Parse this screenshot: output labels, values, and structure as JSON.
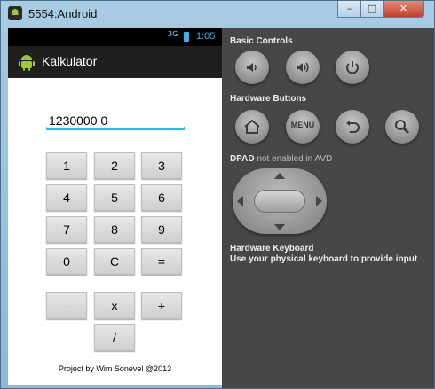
{
  "window": {
    "title": "5554:Android",
    "minimize_icon": "minimize-icon",
    "maximize_icon": "maximize-icon",
    "close_icon": "close-icon"
  },
  "statusbar": {
    "signal": "3G",
    "time": "1:05"
  },
  "app": {
    "title": "Kalkulator",
    "icon": "android-robot-icon"
  },
  "calculator": {
    "display": "1230000.0",
    "keys": [
      "1",
      "2",
      "3",
      "4",
      "5",
      "6",
      "7",
      "8",
      "9",
      "0",
      "C",
      "=",
      "-",
      "x",
      "+",
      "/"
    ],
    "footer": "Project by Wim Sonevel @2013"
  },
  "controls": {
    "basic_title": "Basic Controls",
    "basic": [
      {
        "icon": "volume-down-icon"
      },
      {
        "icon": "volume-up-icon"
      },
      {
        "icon": "power-icon"
      }
    ],
    "hardware_title": "Hardware Buttons",
    "hardware": [
      {
        "icon": "home-icon"
      },
      {
        "label": "MENU"
      },
      {
        "icon": "back-icon"
      },
      {
        "icon": "search-icon"
      }
    ],
    "dpad_title": "DPAD",
    "dpad_note": "not enabled in AVD",
    "keyboard_title": "Hardware Keyboard",
    "keyboard_text": "Use your physical keyboard to provide input"
  },
  "colors": {
    "accent": "#33b5e5",
    "panel": "#474747",
    "actionbar": "#1f1f1f"
  }
}
